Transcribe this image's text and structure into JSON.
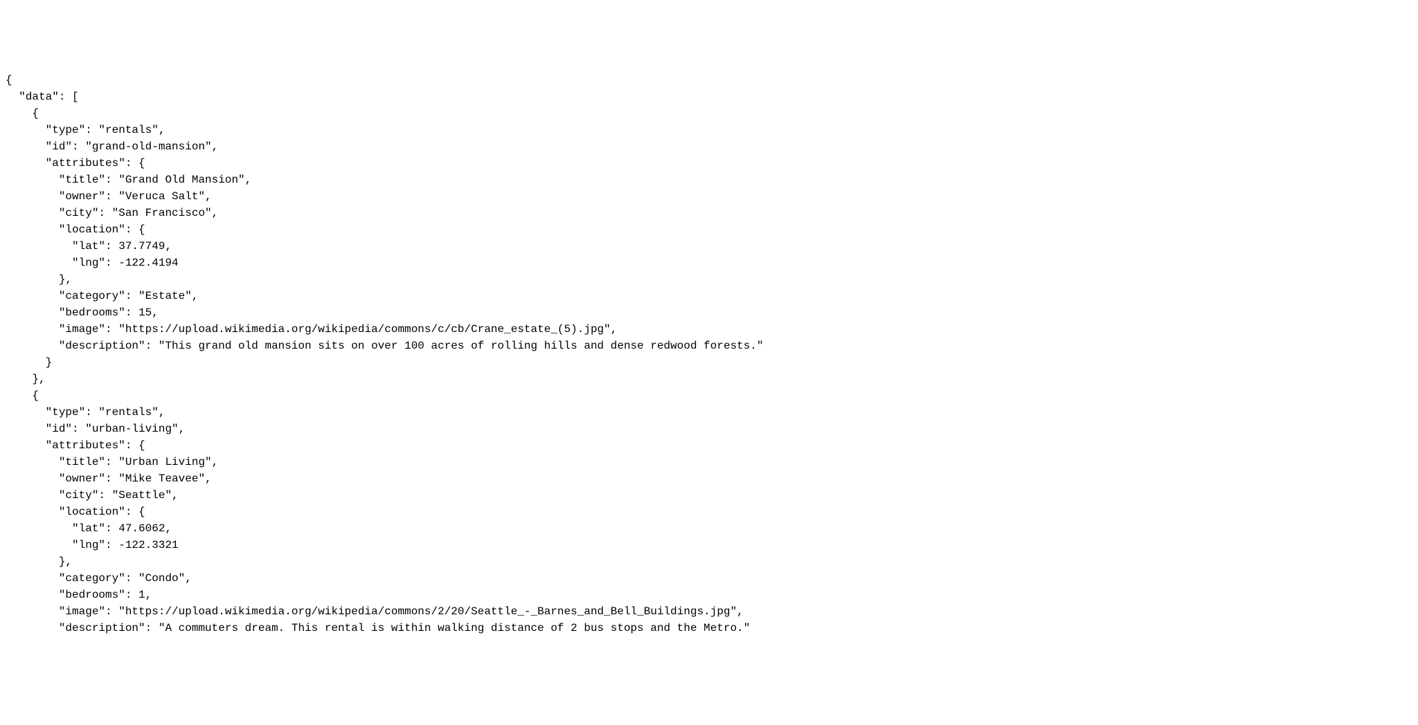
{
  "code": {
    "l01": "{",
    "l02": "  \"data\": [",
    "l03": "    {",
    "l04": "      \"type\": \"rentals\",",
    "l05": "      \"id\": \"grand-old-mansion\",",
    "l06": "      \"attributes\": {",
    "l07": "        \"title\": \"Grand Old Mansion\",",
    "l08": "        \"owner\": \"Veruca Salt\",",
    "l09": "        \"city\": \"San Francisco\",",
    "l10": "        \"location\": {",
    "l11": "          \"lat\": 37.7749,",
    "l12": "          \"lng\": -122.4194",
    "l13": "        },",
    "l14": "        \"category\": \"Estate\",",
    "l15": "        \"bedrooms\": 15,",
    "l16": "        \"image\": \"https://upload.wikimedia.org/wikipedia/commons/c/cb/Crane_estate_(5).jpg\",",
    "l17": "        \"description\": \"This grand old mansion sits on over 100 acres of rolling hills and dense redwood forests.\"",
    "l18": "      }",
    "l19": "    },",
    "l20": "    {",
    "l21": "      \"type\": \"rentals\",",
    "l22": "      \"id\": \"urban-living\",",
    "l23": "      \"attributes\": {",
    "l24": "        \"title\": \"Urban Living\",",
    "l25": "        \"owner\": \"Mike Teavee\",",
    "l26": "        \"city\": \"Seattle\",",
    "l27": "        \"location\": {",
    "l28": "          \"lat\": 47.6062,",
    "l29": "          \"lng\": -122.3321",
    "l30": "        },",
    "l31": "        \"category\": \"Condo\",",
    "l32": "        \"bedrooms\": 1,",
    "l33": "        \"image\": \"https://upload.wikimedia.org/wikipedia/commons/2/20/Seattle_-_Barnes_and_Bell_Buildings.jpg\",",
    "l34": "        \"description\": \"A commuters dream. This rental is within walking distance of 2 bus stops and the Metro.\""
  }
}
